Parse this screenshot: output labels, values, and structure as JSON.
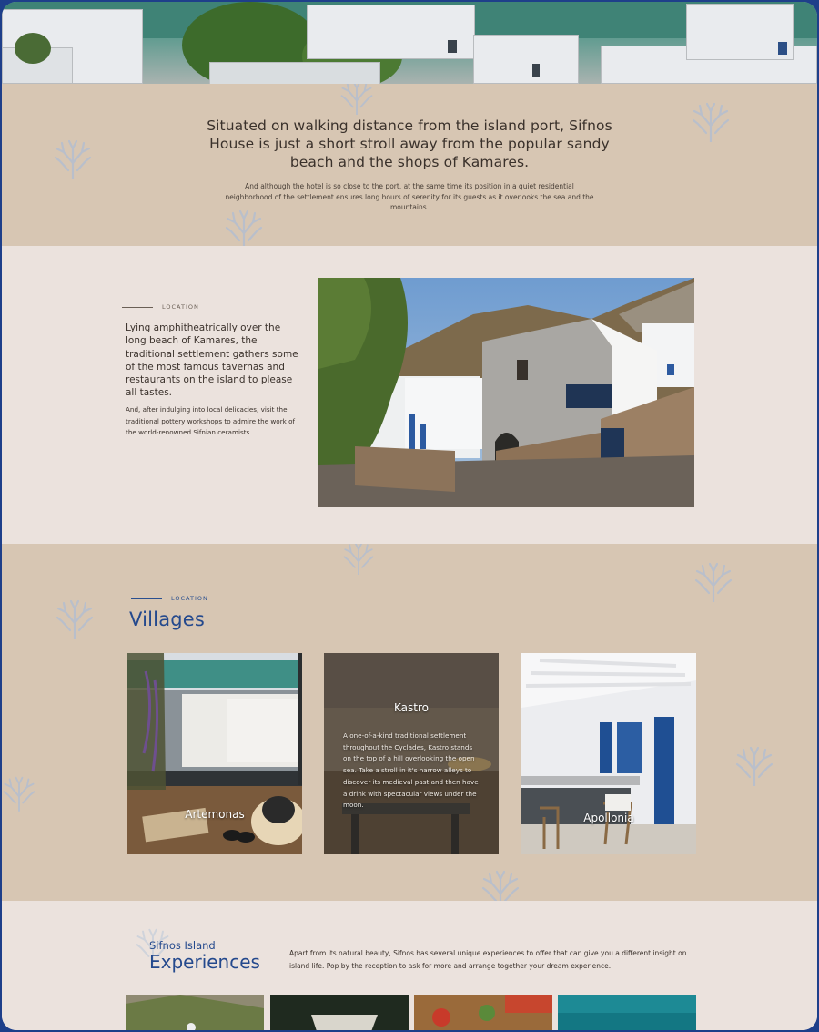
{
  "intro": {
    "heading": "Situated on walking distance from the island port, Sifnos House is just a short stroll away from the popular sandy beach and the shops of Kamares.",
    "text": "And although the hotel is so close to the port, at the same time its position in a quiet residential neighborhood of the settlement ensures long hours of serenity for its guests as it overlooks the sea and the mountains."
  },
  "location": {
    "eyebrow": "LOCATION",
    "lead": "Lying amphitheatrically over the long beach of Kamares, the traditional settlement gathers some of the most famous tavernas and restaurants on the island to please all tastes.",
    "body": "And, after indulging into local delicacies, visit the traditional pottery workshops to admire the work of the world-renowned Sifnian ceramists."
  },
  "villages": {
    "eyebrow": "LOCATION",
    "title": "Villages",
    "cards": [
      {
        "name": "Artemonas",
        "description": ""
      },
      {
        "name": "Kastro",
        "description": "A one-of-a-kind traditional settlement throughout the Cyclades, Kastro stands on the top of a hill overlooking the open sea. Take a stroll in it's narrow alleys to discover its medieval past and then have a drink with spectacular views under the moon."
      },
      {
        "name": "Apollonia",
        "description": ""
      }
    ]
  },
  "experiences": {
    "subtitle": "Sifnos Island",
    "title": "Experiences",
    "text": "Apart from its natural beauty, Sifnos has several unique experiences to offer that can give you a different insight on island life. Pop by the reception to ask for more and arrange together your dream experience."
  },
  "colors": {
    "sand": "#d7c6b3",
    "cream": "#ebe2dd",
    "accent_blue": "#24498d",
    "coral_icon": "#b9bfcb"
  },
  "icons": [
    "coral-icon"
  ]
}
